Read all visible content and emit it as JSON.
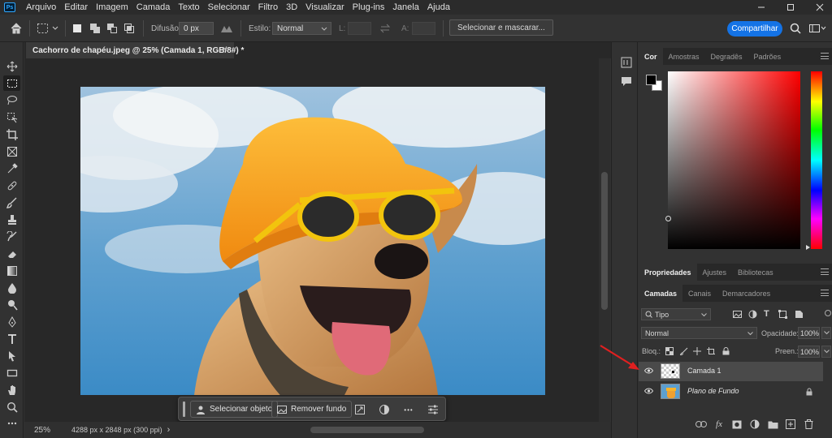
{
  "app": {
    "logo_text": "Ps"
  },
  "menu": [
    "Arquivo",
    "Editar",
    "Imagem",
    "Camada",
    "Texto",
    "Selecionar",
    "Filtro",
    "3D",
    "Visualizar",
    "Plug-ins",
    "Janela",
    "Ajuda"
  ],
  "options_bar": {
    "feather_label": "Difusão:",
    "feather_value": "0 px",
    "style_label": "Estilo:",
    "style_value": "Normal",
    "width_label": "L:",
    "height_label": "A:",
    "select_mask_label": "Selecionar e mascarar...",
    "share_label": "Compartilhar"
  },
  "document": {
    "tab_title": "Cachorro de chapéu.jpeg @ 25% (Camada 1, RGB/8#) *",
    "close_glyph": "×",
    "zoom": "25%",
    "info": "4288 px x 2848 px (300 ppi)",
    "status_arrow": "›"
  },
  "context_bar": {
    "select_subject_label": "Selecionar objeto",
    "remove_bg_label": "Remover fundo",
    "more_glyph": "•••"
  },
  "color_panel": {
    "tabs": [
      "Cor",
      "Amostras",
      "Degradês",
      "Padrões"
    ],
    "active_tab": 0,
    "foreground": "#000000",
    "background": "#ffffff",
    "hue_color": "#ff0000"
  },
  "properties_panel": {
    "tabs": [
      "Propriedades",
      "Ajustes",
      "Bibliotecas"
    ],
    "active_tab": 0
  },
  "layers_panel": {
    "tabs": [
      "Camadas",
      "Canais",
      "Demarcadores"
    ],
    "active_tab": 0,
    "filter_label": "Tipo",
    "blend_mode": "Normal",
    "opacity_label": "Opacidade:",
    "opacity_value": "100%",
    "lock_label": "Bloq.:",
    "fill_label": "Preen.:",
    "fill_value": "100%",
    "fx_label": "fx",
    "layers": [
      {
        "name": "Camada 1",
        "selected": true,
        "italic": false,
        "locked": false
      },
      {
        "name": "Plano de Fundo",
        "selected": false,
        "italic": true,
        "locked": true
      }
    ]
  },
  "accent_colors": {
    "share_button": "#1473e6",
    "annotation_arrow": "#e02020"
  }
}
